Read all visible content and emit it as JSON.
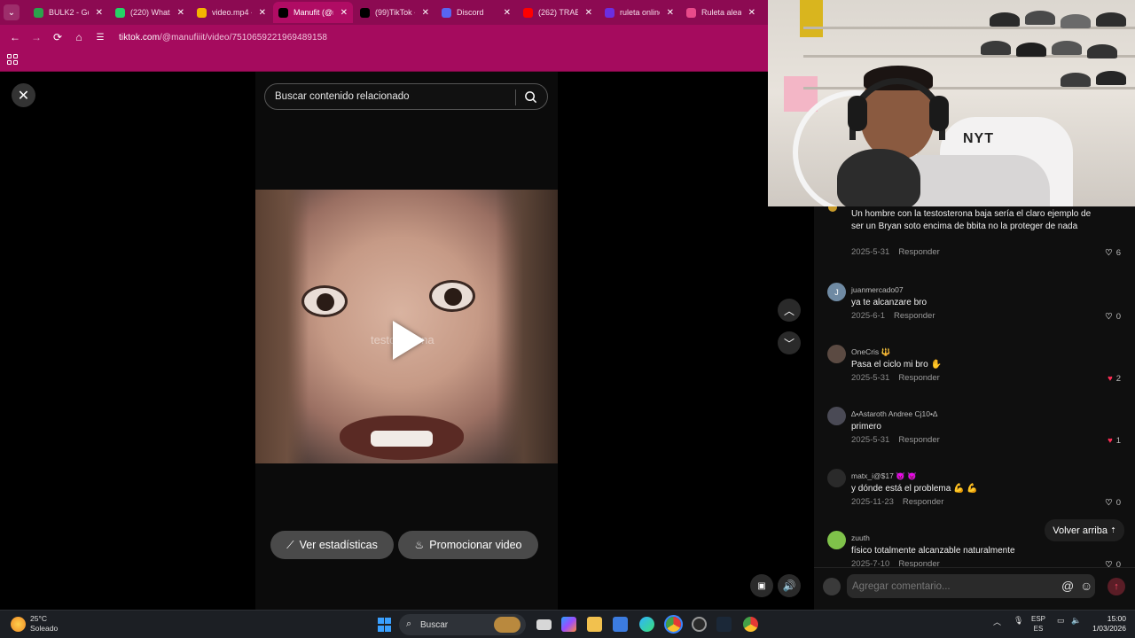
{
  "browser": {
    "tabs": [
      {
        "title": "BULK2 - Goo",
        "color": "#2ba24c"
      },
      {
        "title": "(220) Whats",
        "color": "#25d366"
      },
      {
        "title": "video.mp4 -",
        "color": "#f4b400"
      },
      {
        "title": "Manufit (@m",
        "color": "#000000",
        "active": true
      },
      {
        "title": "(99)TikTok -",
        "color": "#000000"
      },
      {
        "title": "Discord",
        "color": "#5865f2"
      },
      {
        "title": "(262) TRABA",
        "color": "#ff0000"
      },
      {
        "title": "ruleta online",
        "color": "#6b2ee0"
      },
      {
        "title": "Ruleta aleato",
        "color": "#e84a8a"
      }
    ],
    "url_host": "tiktok.com",
    "url_path": "/@manufiiit/video/7510659221969489158",
    "accent": "#a50b5e"
  },
  "player": {
    "close_icon": "close-icon",
    "search_placeholder": "Buscar contenido relacionado",
    "overlay_text": "testosterona",
    "stats_label": "Ver estadísticas",
    "promote_label": "Promocionar video"
  },
  "comments": {
    "items": [
      {
        "user": "",
        "text": "Un hombre con la testosterona baja sería el claro ejemplo de ser un Bryan soto encima de bbita no la proteger de nada",
        "date": "2025-5-31",
        "reply": "Responder",
        "likes": "6",
        "liked": false,
        "avatar_color": "#c79a2a",
        "avatar_letter": ""
      },
      {
        "user": "juanmercado07",
        "text": "ya te alcanzare bro",
        "date": "2025-6-1",
        "reply": "Responder",
        "likes": "0",
        "liked": false,
        "avatar_color": "#6f8aa3",
        "avatar_letter": "J"
      },
      {
        "user": "OneCris 🔱",
        "text": "Pasa el ciclo mi bro ✋",
        "date": "2025-5-31",
        "reply": "Responder",
        "likes": "2",
        "liked": true,
        "avatar_color": "#5b4a42",
        "avatar_letter": ""
      },
      {
        "user": "∆•Astaroth Andree Cj10•∆",
        "text": "primero",
        "date": "2025-5-31",
        "reply": "Responder",
        "likes": "1",
        "liked": true,
        "avatar_color": "#4a4a55",
        "avatar_letter": ""
      },
      {
        "user": "matx_i@$17 👿 👿",
        "text": "y dónde está el problema 💪 💪",
        "date": "2025-11-23",
        "reply": "Responder",
        "likes": "0",
        "liked": false,
        "avatar_color": "#2a2a2a",
        "avatar_letter": ""
      },
      {
        "user": "zuuth",
        "text": "físico totalmente alcanzable naturalmente",
        "date": "2025-7-10",
        "reply": "Responder",
        "likes": "0",
        "liked": false,
        "avatar_color": "#7fc24a",
        "avatar_letter": ""
      }
    ],
    "back_top_label": "Volver arriba",
    "input_placeholder": "Agregar comentario..."
  },
  "webcam": {
    "shirt_text": "NYT"
  },
  "taskbar": {
    "temp": "25°C",
    "weather": "Soleado",
    "search_label": "Buscar",
    "lang_top": "ESP",
    "lang_bottom": "ES",
    "time": "15:00",
    "date": "1/03/2026"
  }
}
